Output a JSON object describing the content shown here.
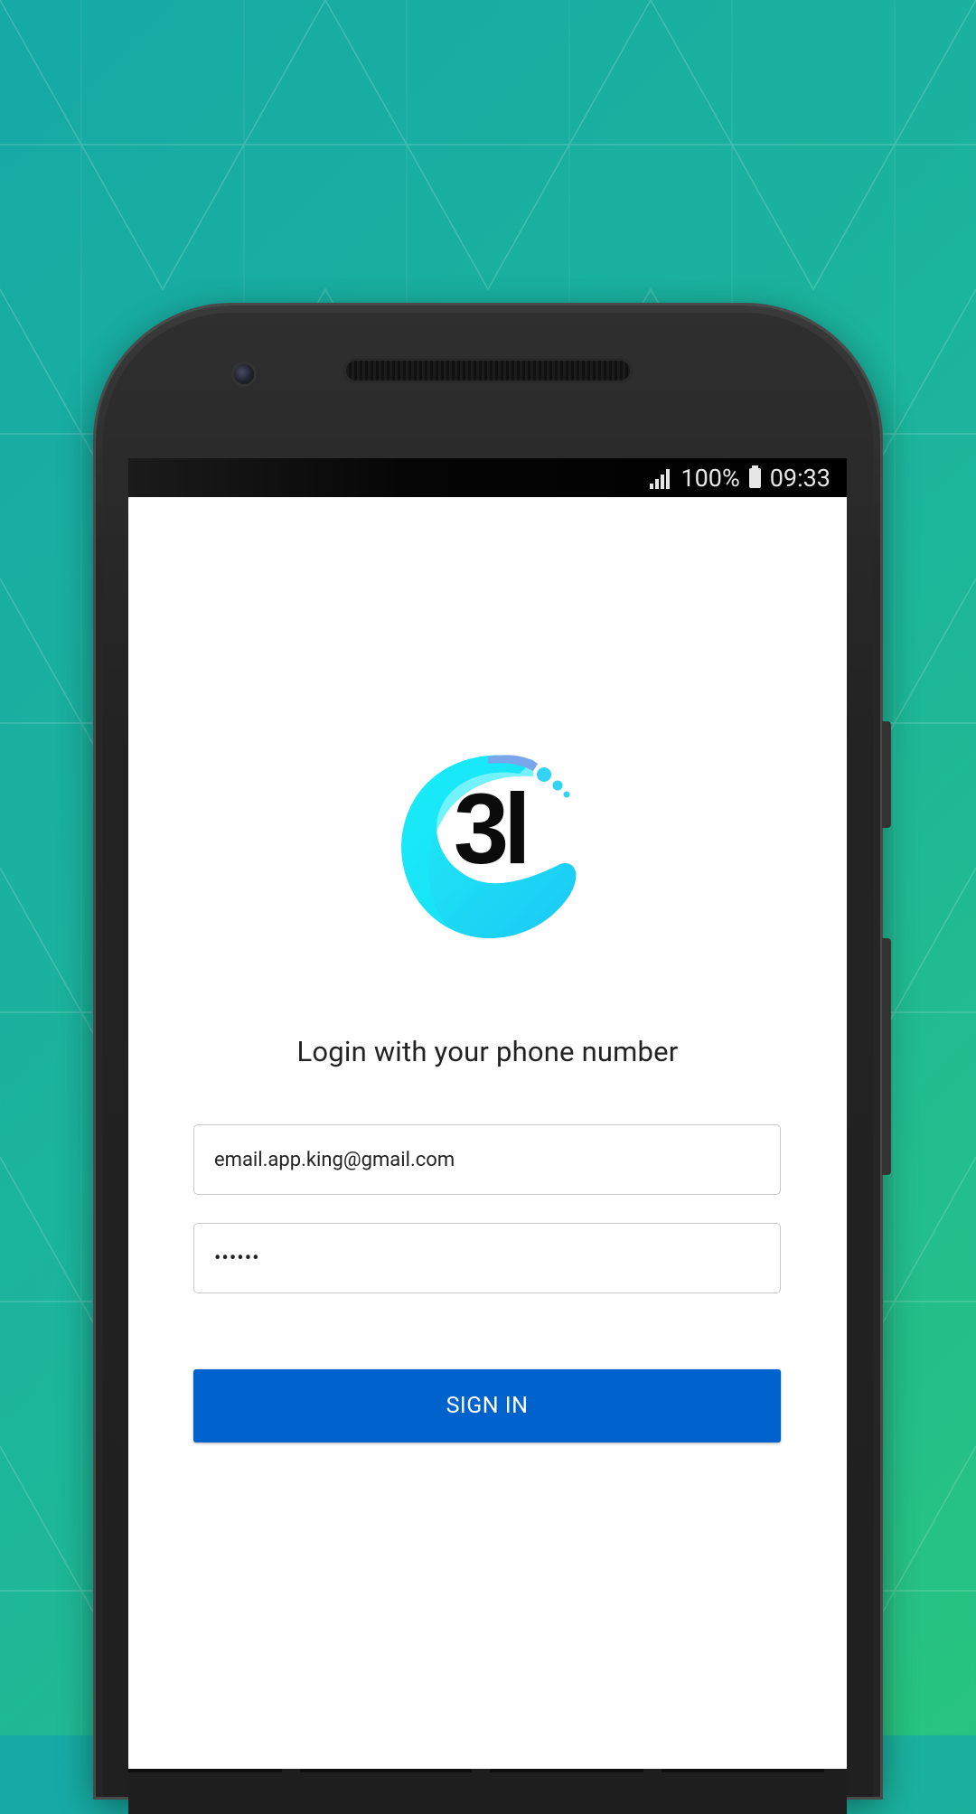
{
  "status_bar": {
    "battery": "100%",
    "time": "09:33"
  },
  "login": {
    "heading": "Login with your phone number",
    "email_value": "email.app.king@gmail.com",
    "password_value": "••••••",
    "signin_label": "SIGN IN"
  },
  "logo": {
    "text": "3l"
  },
  "colors": {
    "background_gradient_start": "#16a9a5",
    "background_gradient_end": "#28c47f",
    "button_blue": "#0063cd",
    "logo_cyan": "#1ee8f5"
  }
}
